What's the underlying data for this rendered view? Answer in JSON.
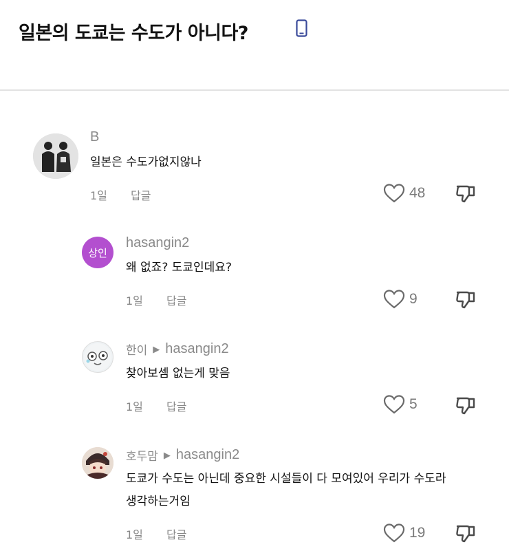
{
  "page": {
    "title": "일본의 도쿄는 수도가 아니다?",
    "title_icon": "mobile-phone-icon"
  },
  "comments": [
    {
      "user": "B",
      "reply_to": "",
      "text": [
        "일본은 수도가없지않나"
      ],
      "time": "1일",
      "reply_label": "답글",
      "likes": "48",
      "avatar": "figures-avatar"
    },
    {
      "user": "hasangin2",
      "reply_to": "",
      "avatar_text": "상인",
      "avatar_color": "#b34fcf",
      "text": [
        "왜 없죠? 도쿄인데요?"
      ],
      "time": "1일",
      "reply_label": "답글",
      "likes": "9"
    },
    {
      "user": "한이",
      "reply_to": "hasangin2",
      "text": [
        "찾아보셈 없는게 맞음"
      ],
      "time": "1일",
      "reply_label": "답글",
      "likes": "5",
      "avatar": "cartoon-face-avatar"
    },
    {
      "user": "호두맘",
      "reply_to": "hasangin2",
      "text": [
        "도쿄가 수도는 아닌데 중요한 시설들이 다 모여있어 우리가 수도라",
        "생각하는거임"
      ],
      "time": "1일",
      "reply_label": "답글",
      "likes": "19",
      "avatar": "anime-character-avatar"
    }
  ]
}
